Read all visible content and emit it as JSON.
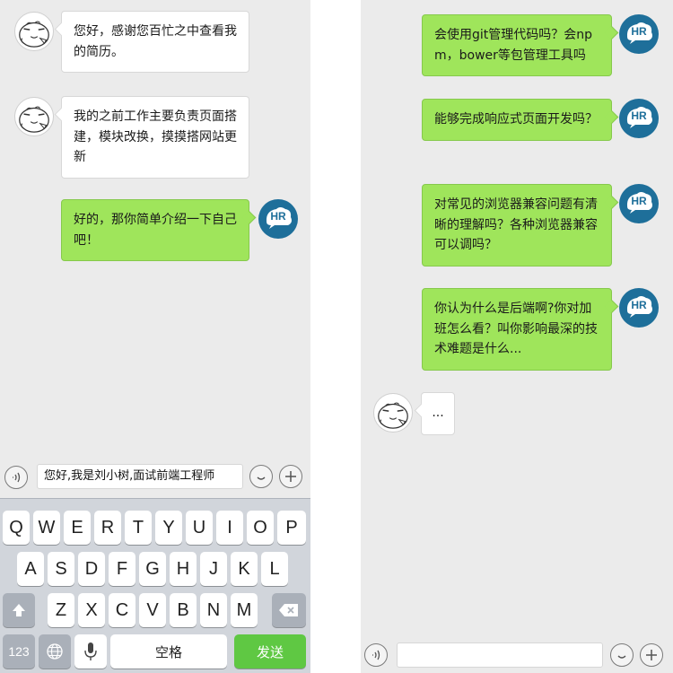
{
  "left": {
    "messages": [
      {
        "from": "candidate",
        "text": "您好，感谢您百忙之中查看我的简历。"
      },
      {
        "from": "candidate",
        "text": "我的之前工作主要负责页面搭建，模块改换，摸摸搭网站更新"
      },
      {
        "from": "hr",
        "text": "好的，那你简单介绍一下自己吧！"
      }
    ],
    "input_value": "您好,我是刘小树,面试前端工程师",
    "keyboard": {
      "row1": [
        "Q",
        "W",
        "E",
        "R",
        "T",
        "Y",
        "U",
        "I",
        "O",
        "P"
      ],
      "row2": [
        "A",
        "S",
        "D",
        "F",
        "G",
        "H",
        "J",
        "K",
        "L"
      ],
      "row3": [
        "Z",
        "X",
        "C",
        "V",
        "B",
        "N",
        "M"
      ],
      "numbers_key": "123",
      "space_key": "空格",
      "send_key": "发送"
    }
  },
  "right": {
    "messages": [
      {
        "from": "hr",
        "text": "会使用git管理代码吗？会npm，bower等包管理工具吗"
      },
      {
        "from": "hr",
        "text": "能够完成响应式页面开发吗？"
      },
      {
        "from": "hr",
        "text": "对常见的浏览器兼容问题有清晰的理解吗？各种浏览器兼容可以调吗？"
      },
      {
        "from": "hr",
        "text": "你认为什么是后端啊?你对加班怎么看？叫你影响最深的技术难题是什么..."
      },
      {
        "from": "candidate",
        "text": "..."
      }
    ],
    "input_value": ""
  },
  "hr_avatar_label": "HR",
  "icons": {
    "voice": "voice-icon",
    "emoji": "emoji-icon",
    "plus": "plus-icon",
    "shift": "shift-icon",
    "backspace": "backspace-icon",
    "globe": "globe-icon",
    "mic": "microphone-icon"
  },
  "colors": {
    "chat_bg": "#ebebeb",
    "hr_bubble": "#9fe55b",
    "candidate_bubble": "#ffffff",
    "hr_avatar": "#1e6f9a",
    "send_key": "#5fc843"
  }
}
